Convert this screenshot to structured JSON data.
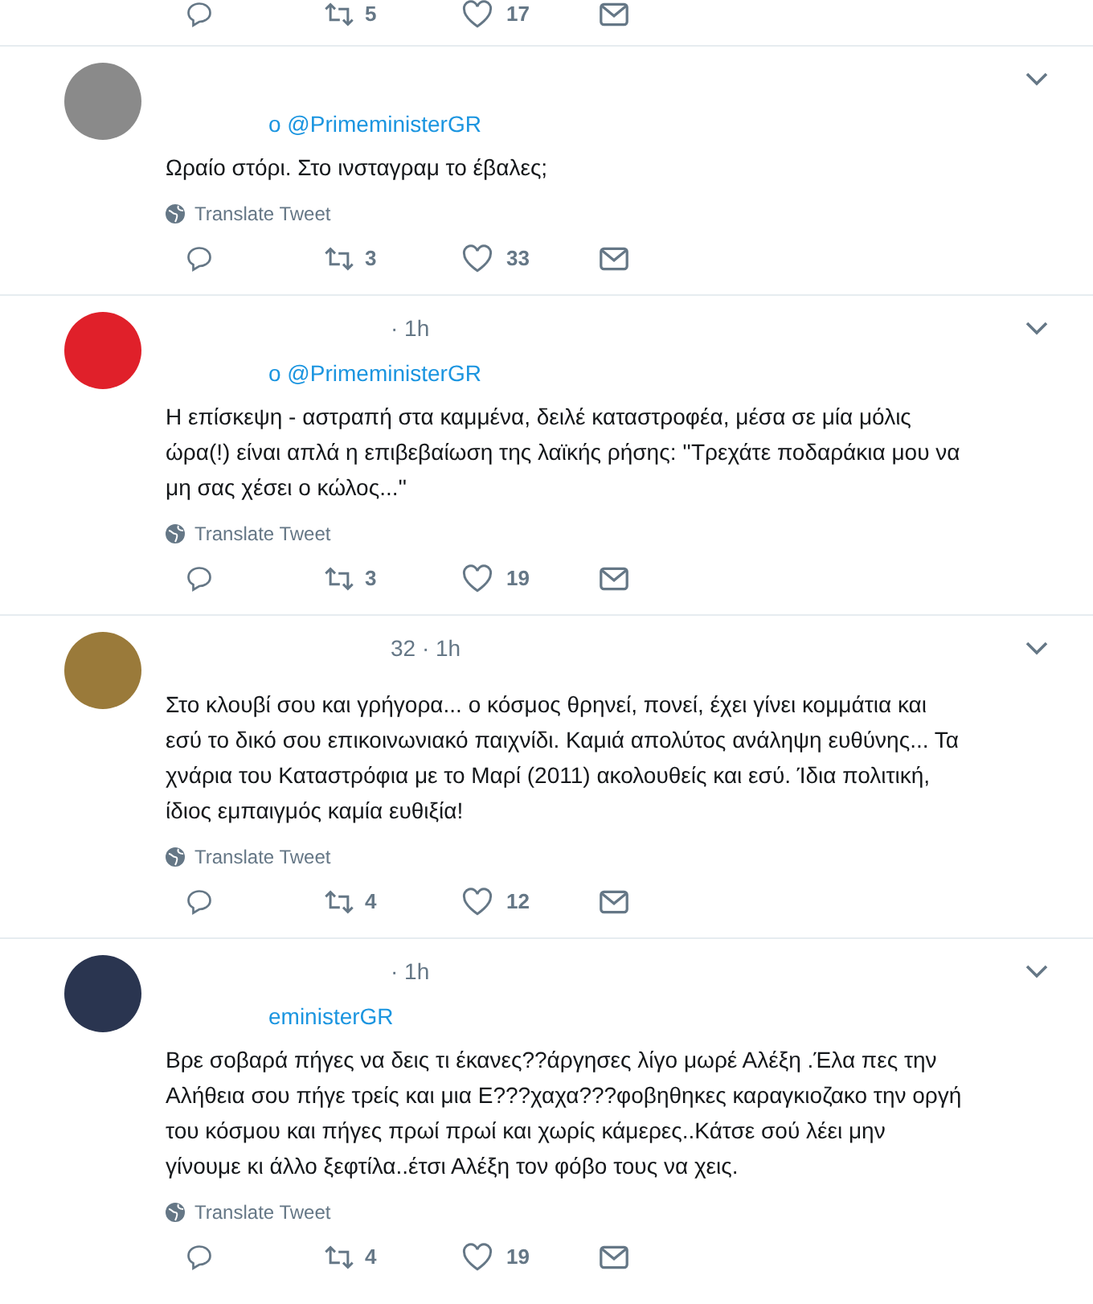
{
  "top_actions": {
    "retweets": "5",
    "likes": "17"
  },
  "tweets": [
    {
      "color": "#8a8a8a",
      "reply_to": "o @PrimeministerGR",
      "text": "Ωραίο στόρι. Στο ινσταγραμ το έβαλες;",
      "translate": "Translate Tweet",
      "retweets": "3",
      "likes": "33"
    },
    {
      "color": "#e0202a",
      "meta": "· 1h",
      "reply_to": "o @PrimeministerGR",
      "text": "Η επίσκεψη - αστραπή στα καμμένα, δειλέ καταστροφέα, μέσα σε μία μόλις ώρα(!) είναι απλά η επιβεβαίωση της λαϊκής ρήσης: ''Τρεχάτε ποδαράκια μου να μη σας χέσει ο κώλος...''",
      "translate": "Translate Tweet",
      "retweets": "3",
      "likes": "19"
    },
    {
      "color": "#9a7a3a",
      "meta": "32 · 1h",
      "text": "Στο κλουβί σου και γρήγορα... ο κόσμος θρηνεί, πονεί, έχει γίνει κομμάτια και εσύ το δικό σου επικοινωνιακό παιχνίδι. Καμιά απολύτος ανάληψη ευθύνης... Τα χνάρια του Καταστρόφια με το Μαρί (2011) ακολουθείς και εσύ. Ίδια πολιτική, ίδιος εμπαιγμός καμία ευθιξία!",
      "translate": "Translate Tweet",
      "retweets": "4",
      "likes": "12"
    },
    {
      "color": "#2a3550",
      "meta": "· 1h",
      "reply_to": "eministerGR",
      "text": "Βρε σοβαρά πήγες να δεις τι έκανες??άργησες λίγο μωρέ Αλέξη .Έλα πες την Αλήθεια σου πήγε τρείς και μια Ε???χαχα???φοβηθηκες καραγκιοζακο την οργή του κόσμου και πήγες πρωί πρωί και χωρίς κάμερες..Κάτσε σού λέει μην γίνουμε κι άλλο ξεφτίλα..έτσι Αλέξη τον φόβο τους να χεις.",
      "translate": "Translate Tweet",
      "retweets": "4",
      "likes": "19"
    }
  ]
}
